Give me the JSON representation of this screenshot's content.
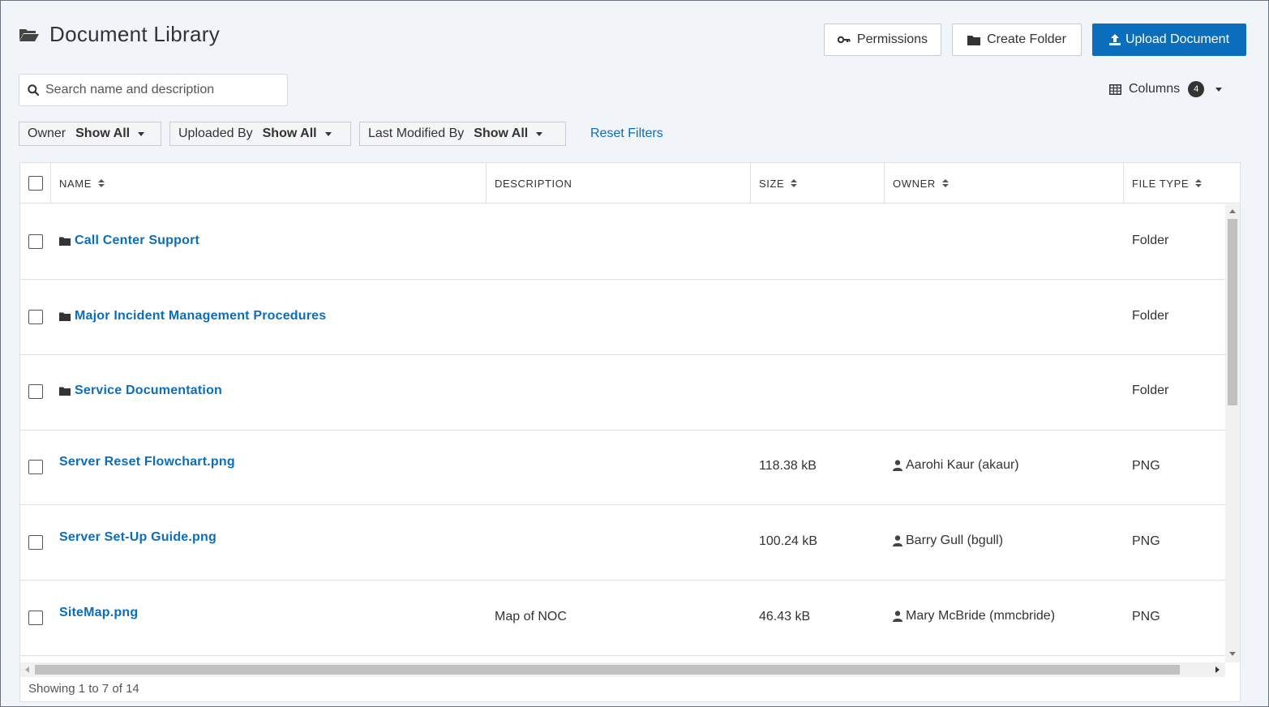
{
  "header": {
    "title": "Document Library",
    "icon": "folder-open-icon"
  },
  "actions": {
    "permissions_label": "Permissions",
    "create_folder_label": "Create Folder",
    "upload_label": "Upload Document"
  },
  "search": {
    "placeholder": "Search name and description",
    "value": ""
  },
  "columns": {
    "label": "Columns",
    "count": "4"
  },
  "filters": [
    {
      "label": "Owner",
      "value": "Show All"
    },
    {
      "label": "Uploaded By",
      "value": "Show All"
    },
    {
      "label": "Last Modified By",
      "value": "Show All"
    }
  ],
  "reset_filters_label": "Reset Filters",
  "table": {
    "headers": {
      "name": "NAME",
      "description": "DESCRIPTION",
      "size": "SIZE",
      "owner": "OWNER",
      "file_type": "FILE TYPE"
    },
    "rows": [
      {
        "name": "Call Center Support",
        "is_folder": true,
        "description": "",
        "size": "",
        "owner": "",
        "file_type": "Folder"
      },
      {
        "name": "Major Incident Management Procedures",
        "is_folder": true,
        "description": "",
        "size": "",
        "owner": "",
        "file_type": "Folder"
      },
      {
        "name": "Service Documentation",
        "is_folder": true,
        "description": "",
        "size": "",
        "owner": "",
        "file_type": "Folder"
      },
      {
        "name": "Server Reset Flowchart.png",
        "is_folder": false,
        "description": "",
        "size": "118.38 kB",
        "owner": "Aarohi Kaur (akaur)",
        "file_type": "PNG"
      },
      {
        "name": "Server Set-Up Guide.png",
        "is_folder": false,
        "description": "",
        "size": "100.24 kB",
        "owner": "Barry Gull (bgull)",
        "file_type": "PNG"
      },
      {
        "name": "SiteMap.png",
        "is_folder": false,
        "description": "Map of NOC",
        "size": "46.43 kB",
        "owner": "Mary McBride (mmcbride)",
        "file_type": "PNG"
      }
    ]
  },
  "footer": {
    "status": "Showing 1 to 7 of 14"
  },
  "colors": {
    "accent": "#0a6ebd",
    "background": "#f1f4f8"
  }
}
